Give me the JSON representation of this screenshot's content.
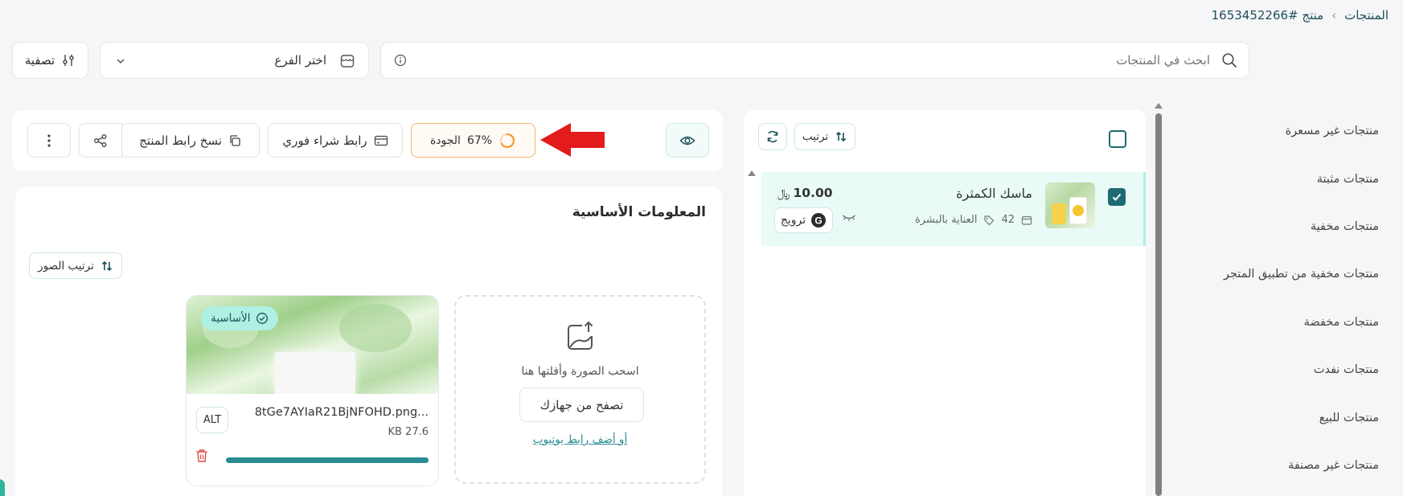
{
  "breadcrumb": {
    "root": "المنتجات",
    "separator": "›",
    "current": "منتج #1653452266"
  },
  "search": {
    "placeholder": "ابحث في المنتجات"
  },
  "branch_select": {
    "value": "اختر الفرع"
  },
  "filter": {
    "label": "تصفية"
  },
  "sidebar": {
    "items": [
      {
        "label": "منتجات غير مسعرة"
      },
      {
        "label": "منتجات مثبتة"
      },
      {
        "label": "منتجات مخفية"
      },
      {
        "label": "منتجات مخفية من تطبيق المتجر"
      },
      {
        "label": "منتجات مخفضة"
      },
      {
        "label": "منتجات نفدت"
      },
      {
        "label": "منتجات للبيع"
      },
      {
        "label": "منتجات غير مصنفة"
      }
    ]
  },
  "list_toolbar": {
    "sort_label": "ترتيب"
  },
  "product": {
    "name": "ماسك الكمثرة",
    "price": "10.00",
    "currency": "﷼",
    "stock": "42",
    "category": "العناية بالبشرة",
    "promote_label": "ترويج",
    "selected": true
  },
  "toolbar": {
    "quality_label": "الجودة",
    "quality_value": "67%",
    "quality_fraction": 0.67,
    "instant_buy_label": "رابط شراء فوري",
    "copy_link_label": "نسخ رابط المنتج"
  },
  "basic_info": {
    "title": "المعلومات الأساسية",
    "sort_images_label": "ترتيب الصور",
    "upload": {
      "drag_text": "اسحب الصورة وأفلتها هنا",
      "browse_label": "تصفح من جهازك",
      "youtube_link": "أو أضف رابط يوتيوب"
    },
    "image": {
      "badge": "الأساسية",
      "filename": "8tGe7AYIaR21BjNFOHD.png...",
      "size": "27.6 KB",
      "alt_label": "ALT",
      "upload_progress": 1.0
    }
  },
  "colors": {
    "accent": "#1e6b73",
    "accent_light": "#e9faf7",
    "badge_bg": "#aef0e2",
    "quality_orange": "#f39c32",
    "arrow_red": "#e31b1b",
    "progress_teal": "#2a8c93"
  }
}
